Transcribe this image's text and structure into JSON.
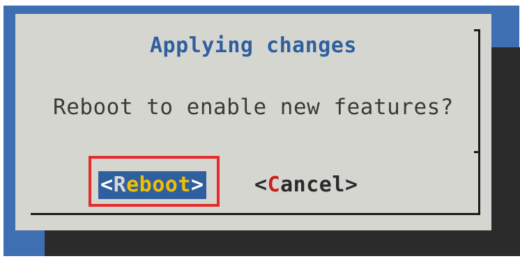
{
  "dialog": {
    "title": "Applying changes",
    "message": "Reboot to enable new features?"
  },
  "buttons": {
    "reboot": {
      "open": "<",
      "hotkey": "R",
      "rest": "eboot",
      "close": ">"
    },
    "cancel": {
      "open": "<",
      "hotkey": "C",
      "rest": "ancel",
      "close": ">"
    }
  },
  "colors": {
    "background_blue": "#3e6fb2",
    "dialog_gray": "#d6d6d0",
    "title_blue": "#2f5f9e",
    "selected_bg": "#2f5f9e",
    "selected_text": "#f0c000",
    "hotkey_red": "#c8201a",
    "annotation_red": "#e52a2a"
  }
}
